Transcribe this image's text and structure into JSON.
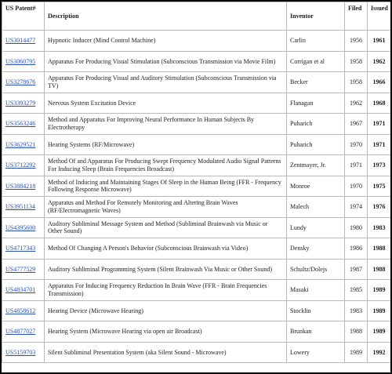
{
  "headers": {
    "patent": "US Patent#",
    "description": "Description",
    "inventor": "Inventor",
    "filed": "Filed",
    "issued": "Issued"
  },
  "rows": [
    {
      "patent": "US3014477",
      "description": "Hypnotic Inducer (Mind Control Machine)",
      "inventor": "Carlin",
      "filed": "1956",
      "issued": "1961"
    },
    {
      "patent": "US3060795",
      "description": "Apparatus For Producing Visual Stimulation (Subconscious Transmission via Movie Film)",
      "inventor": "Corrigan et al",
      "filed": "1958",
      "issued": "1962"
    },
    {
      "patent": "US3278676",
      "description": "Apparatus For Producing Visual and Auditory Stimulation (Subconscious Transmission via TV)",
      "inventor": "Becker",
      "filed": "1958",
      "issued": "1966"
    },
    {
      "patent": "US3393279",
      "description": "Nervous System Excitation Device",
      "inventor": "Flanagan",
      "filed": "1962",
      "issued": "1968"
    },
    {
      "patent": "US3563246",
      "description": "Method and Apparatus For Improving Neural Performance In Human Subjects By Electrotherapy",
      "inventor": "Puharich",
      "filed": "1967",
      "issued": "1971"
    },
    {
      "patent": "US3629521",
      "description": "Hearing Systems (RF/Microwave)",
      "inventor": "Puharich",
      "filed": "1970",
      "issued": "1971"
    },
    {
      "patent": "US3712292",
      "description": "Method Of and Apparatus For Producing Swept Frequency Modulated Audio Signal Patterns For Inducing Sleep (Brain Frequencies Broadcast)",
      "inventor": "Zentmayer, Jr.",
      "filed": "1971",
      "issued": "1973"
    },
    {
      "patent": "US3884218",
      "description": "Method of Inducing and Maintaining Stages Of Sleep in the Human Being (FFR - Frequency Following Response Microwave)",
      "inventor": "Monroe",
      "filed": "1970",
      "issued": "1975"
    },
    {
      "patent": "US3951134",
      "description": "Apparatus and Method For Remotely Monitoring and Altering Brain Waves (RF/Electromagnetic Waves)",
      "inventor": "Malech",
      "filed": "1974",
      "issued": "1976"
    },
    {
      "patent": "US4395600",
      "description": "Auditory Subliminal Message System and Method (Subliminal Brainwash via Music or Other Sound)",
      "inventor": "Lundy",
      "filed": "1980",
      "issued": "1983"
    },
    {
      "patent": "US4717343",
      "description": "Method Of Changing A Person's Behavior (Subconscious Brainwash via Video)",
      "inventor": "Densky",
      "filed": "1986",
      "issued": "1988"
    },
    {
      "patent": "US4777529",
      "description": "Auditory Subliminal Programming System (Silent Brainwash Via Music or Other Sound)",
      "inventor": "Schultz/Dolejs",
      "filed": "1987",
      "issued": "1988"
    },
    {
      "patent": "US4834701",
      "description": "Apparatus For Inducing Frequency Reduction In Brain Wave (FFR - Brain Frequencies Transmission)",
      "inventor": "Masaki",
      "filed": "1985",
      "issued": "1989"
    },
    {
      "patent": "US4858612",
      "description": "Hearing Device (Microwave Hearing)",
      "inventor": "Stocklin",
      "filed": "1983",
      "issued": "1989"
    },
    {
      "patent": "US4877027",
      "description": "Hearing System (Microwave Hearing via open air Broadcast)",
      "inventor": "Brunkan",
      "filed": "1988",
      "issued": "1989"
    },
    {
      "patent": "US5159703",
      "description": "Silent Subliminal Presentation System (aka Silent Sound - Microwave)",
      "inventor": "Lowery",
      "filed": "1989",
      "issued": "1992"
    }
  ]
}
